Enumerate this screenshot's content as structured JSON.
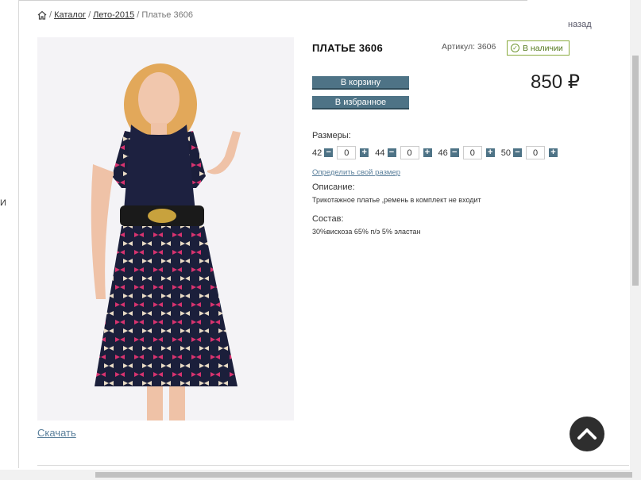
{
  "breadcrumb": {
    "home_icon": "home-icon",
    "items": [
      "Каталог",
      "Лето-2015"
    ],
    "current": "Платье 3606"
  },
  "left_fragment": "И",
  "back": "назад",
  "product": {
    "title": "ПЛАТЬЕ 3606",
    "sku": "Артикул: 3606",
    "stock": "В наличии",
    "price": "850 ₽",
    "cart_button": "В корзину",
    "fav_button": "В избранное",
    "sizes_label": "Размеры:",
    "sizes": [
      {
        "size": "42",
        "qty": "0"
      },
      {
        "size": "44",
        "qty": "0"
      },
      {
        "size": "46",
        "qty": "0"
      },
      {
        "size": "50",
        "qty": "0"
      }
    ],
    "size_link": "Определить свой размер",
    "description_label": "Описание:",
    "description": "Трикотажное платье ,ремень в комплект не входит",
    "composition_label": "Состав:",
    "composition": "30%вискоза 65% п/э 5% эластан"
  },
  "download": "Скачать",
  "colors": {
    "button": "#4e7386",
    "link": "#5a7f9b",
    "stock_border": "#8bab3f"
  },
  "icons": {
    "stock": "check-circle-icon",
    "scroll_top": "chevron-up-icon",
    "minus": "minus-icon",
    "plus": "plus-icon"
  }
}
